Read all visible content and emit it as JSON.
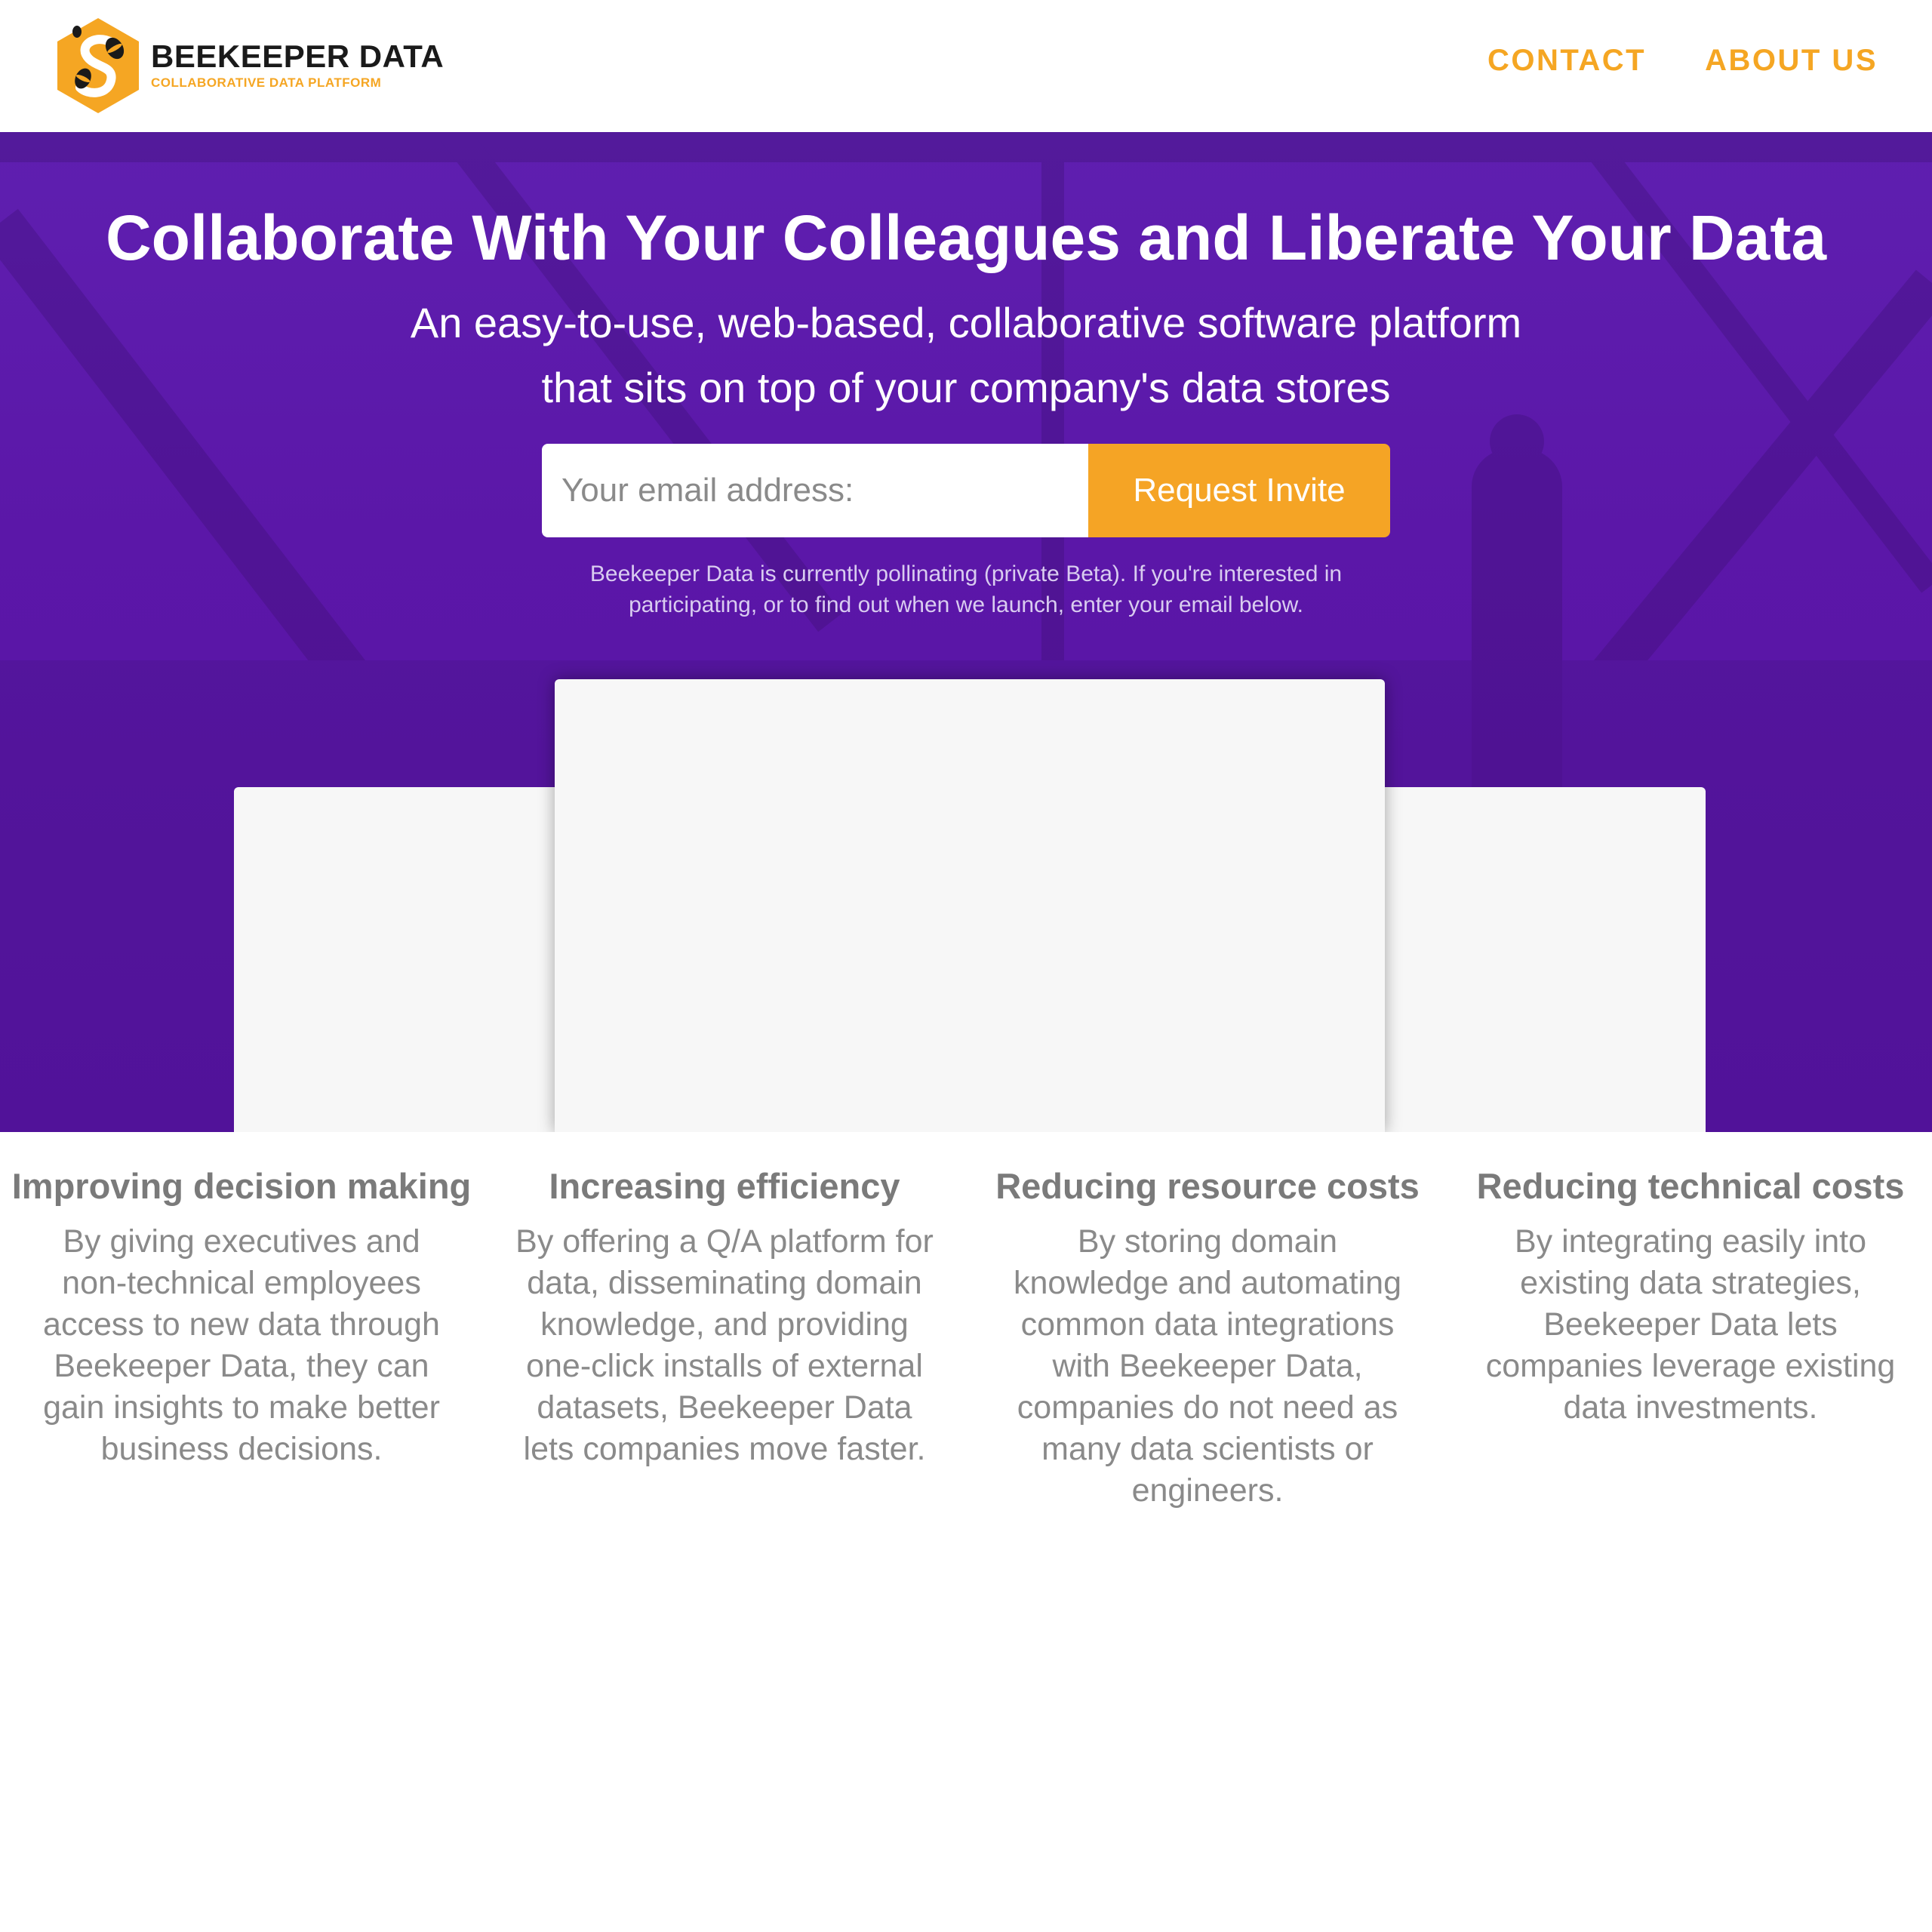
{
  "brand": {
    "name": "BEEKEEPER DATA",
    "tagline": "COLLABORATIVE DATA PLATFORM",
    "primary_color": "#5b17a8",
    "accent_color": "#f5a623",
    "logo_icon": "hexagon-bee-icon"
  },
  "nav": {
    "items": [
      {
        "label": "CONTACT"
      },
      {
        "label": "ABOUT US"
      }
    ]
  },
  "hero": {
    "title": "Collaborate With Your Colleagues and Liberate Your Data",
    "subtitle_line1": "An easy-to-use, web-based, collaborative software platform",
    "subtitle_line2": "that sits on top of your company's data stores",
    "email_placeholder": "Your email address:",
    "email_value": "",
    "cta_label": "Request Invite",
    "beta_note": "Beekeeper Data is currently pollinating (private Beta). If you're interested in participating, or to find out when we launch, enter your email below."
  },
  "features": [
    {
      "title": "Improving decision making",
      "body": "By giving executives and non-technical employees access to new data through Beekeeper Data, they can gain insights to make better business decisions."
    },
    {
      "title": "Increasing efficiency",
      "body": "By offering a Q/A platform for data, disseminating domain knowledge, and providing one-click installs of external datasets, Beekeeper Data lets companies move faster."
    },
    {
      "title": "Reducing resource costs",
      "body": "By storing domain knowledge and automating common data integrations with Beekeeper Data, companies do not need as many data scientists or engineers."
    },
    {
      "title": "Reducing technical costs",
      "body": "By integrating easily into existing data strategies, Beekeeper Data lets companies leverage existing data investments."
    }
  ]
}
